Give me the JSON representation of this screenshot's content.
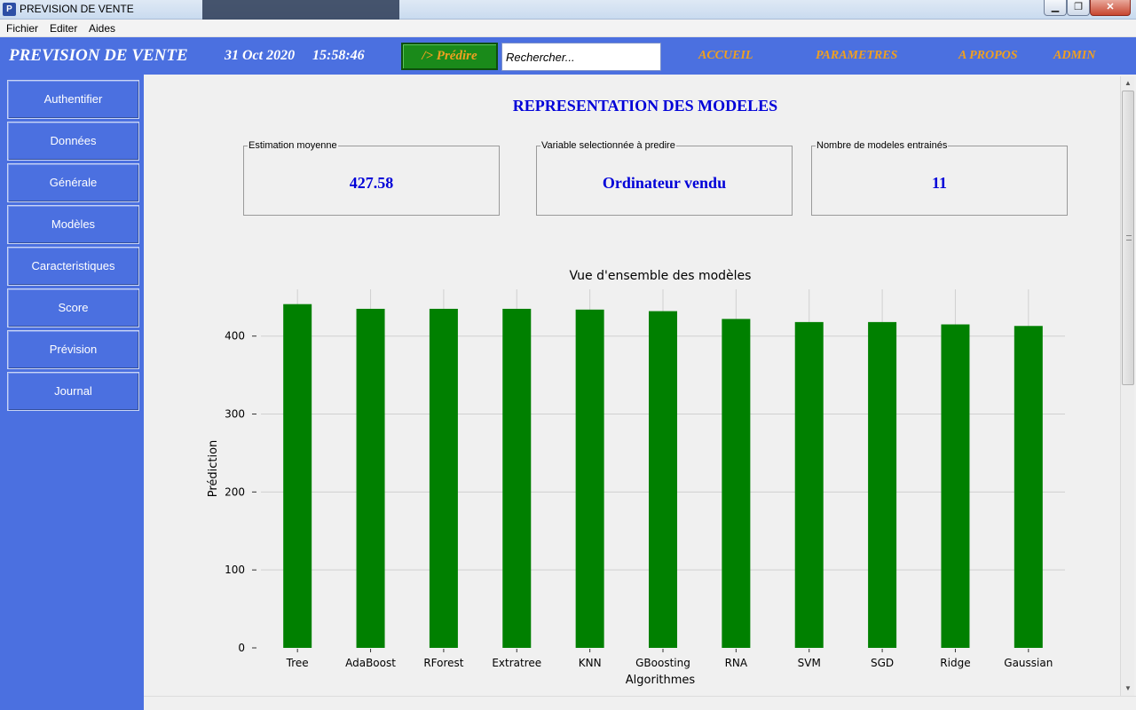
{
  "window": {
    "title": "PREVISION DE VENTE"
  },
  "menu": [
    "Fichier",
    "Editer",
    "Aides"
  ],
  "header": {
    "brand": "PREVISION DE VENTE",
    "date": "31 Oct 2020",
    "time": "15:58:46",
    "predict_label": "/> Prédire",
    "search_value": "Rechercher...",
    "nav": [
      "ACCUEIL",
      "PARAMETRES",
      "A PROPOS",
      "ADMIN"
    ]
  },
  "sidebar": {
    "items": [
      "Authentifier",
      "Données",
      "Générale",
      "Modèles",
      "Caracteristiques",
      "Score",
      "Prévision",
      "Journal"
    ]
  },
  "main": {
    "title": "REPRESENTATION DES MODELES",
    "kpis": [
      {
        "label": "Estimation moyenne",
        "value": "427.58"
      },
      {
        "label": "Variable selectionnée à predire",
        "value": "Ordinateur vendu"
      },
      {
        "label": "Nombre de modeles entrainés",
        "value": "11"
      }
    ]
  },
  "colors": {
    "accent": "#4b70e0",
    "bar": "#008000",
    "value_text": "#0000d8",
    "link": "#f0a020",
    "predict_bg": "#1a8a1a"
  },
  "chart_data": {
    "type": "bar",
    "title": "Vue d'ensemble des modèles",
    "xlabel": "Algorithmes",
    "ylabel": "Prédiction",
    "categories": [
      "Tree",
      "AdaBoost",
      "RForest",
      "Extratree",
      "KNN",
      "GBoosting",
      "RNA",
      "SVM",
      "SGD",
      "Ridge",
      "Gaussian"
    ],
    "values": [
      441,
      435,
      435,
      435,
      434,
      432,
      422,
      418,
      418,
      415,
      413
    ],
    "ylim": [
      0,
      460
    ],
    "yticks": [
      0,
      100,
      200,
      300,
      400
    ],
    "grid": true
  }
}
